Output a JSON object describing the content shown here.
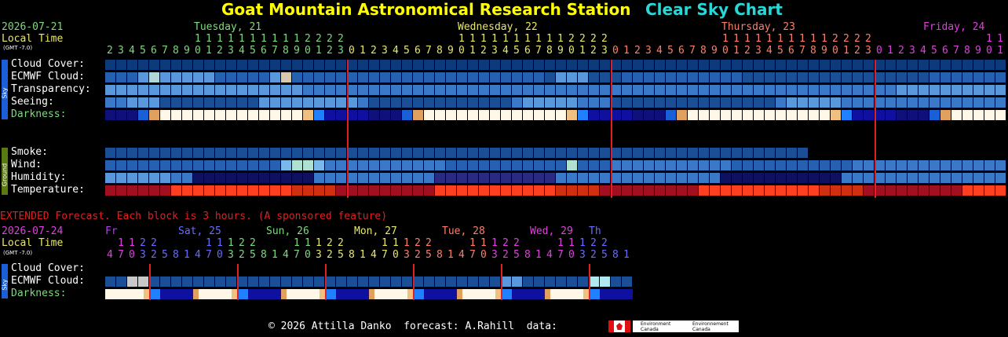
{
  "header": {
    "station": "Goat Mountain Astronomical Research Station",
    "chart_name": "Clear Sky Chart",
    "date": "2026-07-21",
    "local_time_label": "Local Time",
    "gmt_label": "(GMT -7.0)",
    "days": [
      {
        "label": "Tuesday, 21",
        "color": "#7ddb7d"
      },
      {
        "label": "Wednesday, 22",
        "color": "#e8e86a"
      },
      {
        "label": "Thursday, 23",
        "color": "#ff7f6a"
      },
      {
        "label": "Friday, 24",
        "color": "#e040e0"
      }
    ]
  },
  "sidebar": {
    "sky": "Sky",
    "ground": "Ground"
  },
  "rows": {
    "cloud_cover": "Cloud Cover:",
    "ecmwf_cloud": "ECMWF Cloud:",
    "transparency": "Transparency:",
    "seeing": "Seeing:",
    "darkness": "Darkness:",
    "smoke": "Smoke:",
    "wind": "Wind:",
    "humidity": "Humidity:",
    "temperature": "Temperature:"
  },
  "extended": {
    "notice": "EXTENDED Forecast. Each block is 3 hours. (A sponsored feature)",
    "date": "2026-07-24",
    "local_time_label": "Local Time",
    "gmt_label": "(GMT -7.0)",
    "days": [
      {
        "label": "Fr",
        "color": "#b040e0"
      },
      {
        "label": "Sat, 25",
        "color": "#6a6aff"
      },
      {
        "label": "Sun, 26",
        "color": "#7ddb7d"
      },
      {
        "label": "Mon, 27",
        "color": "#e8e86a"
      },
      {
        "label": "Tue, 28",
        "color": "#ff7f6a"
      },
      {
        "label": "Wed, 29",
        "color": "#e040e0"
      },
      {
        "label": "Th",
        "color": "#6a6aff"
      }
    ],
    "rows": {
      "cloud_cover": "Cloud Cover:",
      "ecmwf_cloud": "ECMWF Cloud:",
      "darkness": "Darkness:"
    }
  },
  "footer": {
    "text": "© 2026 Attilla Danko  forecast: A.Rahill  data:",
    "logo_text_1": "Environment Canada",
    "logo_text_2": "Environnement Canada"
  },
  "colors": {
    "title": "#ffff00",
    "chart_name": "#28d8d8",
    "date": "#7ddb7d",
    "local_time": "#e8e86a",
    "notice": "#e02020",
    "midnight_line": "#e02020"
  }
}
